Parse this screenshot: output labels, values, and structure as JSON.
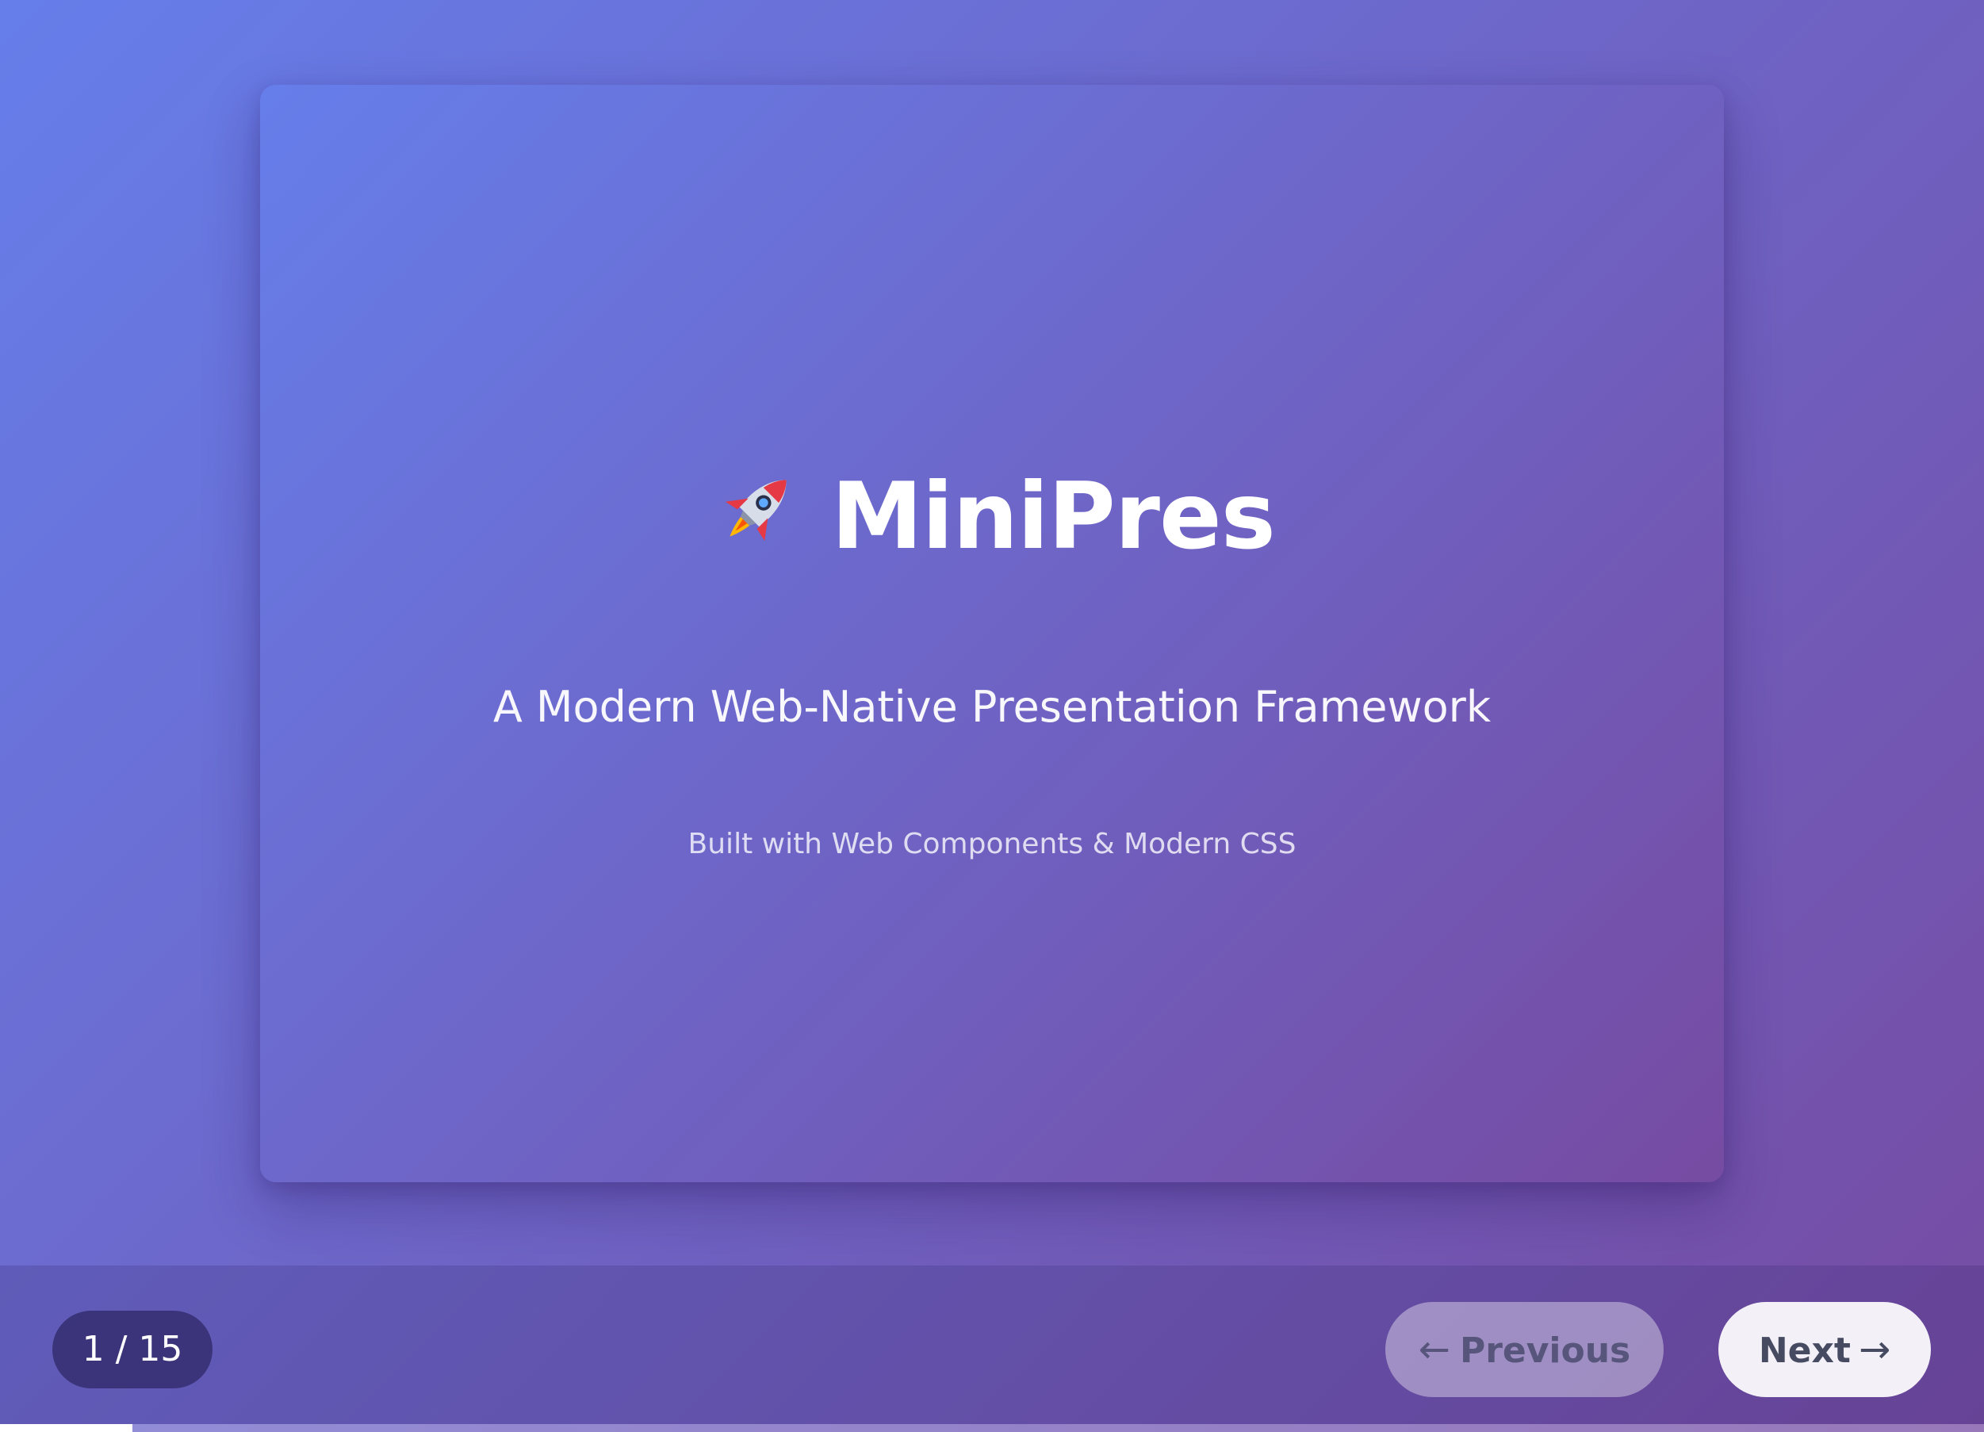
{
  "slide": {
    "title": "MiniPres",
    "icon": "rocket-icon",
    "subtitle": "A Modern Web-Native Presentation Framework",
    "tagline": "Built with Web Components & Modern CSS"
  },
  "controls": {
    "counter": "1 / 15",
    "previous_label": "Previous",
    "previous_arrow": "←",
    "next_label": "Next",
    "next_arrow": "→",
    "previous_disabled": true
  },
  "progress": {
    "current_slide": 1,
    "total_slides": 15,
    "fraction": 0.0667
  },
  "colors": {
    "gradient_start": "#667eea",
    "gradient_end": "#764ba2",
    "text": "#ffffff"
  }
}
